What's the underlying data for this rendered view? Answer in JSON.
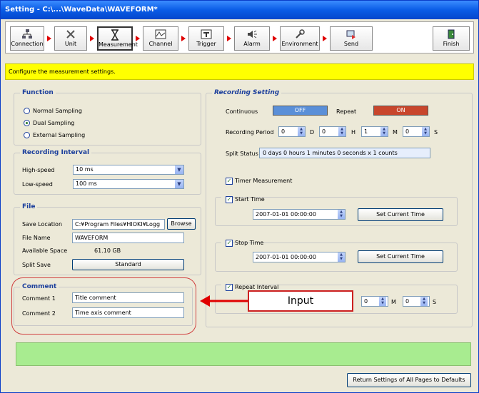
{
  "title": "Setting - C:\\...\\WaveData\\WAVEFORM*",
  "toolbar": {
    "steps": [
      "Connection",
      "Unit",
      "Measurement",
      "Channel",
      "Trigger",
      "Alarm",
      "Environment",
      "Send",
      "Finish"
    ],
    "active": "Measurement"
  },
  "info_text": "Configure the measurement settings.",
  "function": {
    "legend": "Function",
    "options": [
      "Normal Sampling",
      "Dual Sampling",
      "External Sampling"
    ],
    "selected": "Dual Sampling"
  },
  "recording_interval": {
    "legend": "Recording Interval",
    "high_label": "High-speed",
    "high_value": "10 ms",
    "low_label": "Low-speed",
    "low_value": "100 ms"
  },
  "file": {
    "legend": "File",
    "save_location_label": "Save Location",
    "save_location_value": "C:¥Program Files¥HIOKI¥Logg",
    "browse_label": "Browse",
    "file_name_label": "File Name",
    "file_name_value": "WAVEFORM",
    "available_space_label": "Available Space",
    "available_space_value": "61.10 GB",
    "split_save_label": "Split Save",
    "split_save_value": "Standard"
  },
  "comment": {
    "legend": "Comment",
    "comment1_label": "Comment 1",
    "comment1_value": "Title comment",
    "comment2_label": "Comment 2",
    "comment2_value": "Time axis comment"
  },
  "recording_setting": {
    "legend": "Recording Setting",
    "continuous_label": "Continuous",
    "continuous_value": "OFF",
    "repeat_label": "Repeat",
    "repeat_value": "ON",
    "period_label": "Recording Period",
    "period_d": "0",
    "period_h": "0",
    "period_m": "1",
    "period_s": "0",
    "unit_d": "D",
    "unit_h": "H",
    "unit_m": "M",
    "unit_s": "S",
    "split_status_label": "Split Status",
    "split_status_value": "0 days 0 hours 1 minutes 0 seconds x 1 counts",
    "timer_label": "Timer Measurement",
    "start_label": "Start Time",
    "start_value": "2007-01-01 00:00:00",
    "set_current_label": "Set Current Time",
    "stop_label": "Stop Time",
    "stop_value": "2007-01-01 00:00:00",
    "repeat_interval_label": "Repeat Interval",
    "repeat_interval_m": "0",
    "repeat_interval_s": "0"
  },
  "annotation_label": "Input",
  "reset_button": "Return Settings of All Pages to Defaults",
  "colors": {
    "titlebar": "#0a5ce6",
    "info": "#ffff00",
    "off": "#5a8fd8",
    "on": "#c8462c",
    "status_bar": "#a8ec90",
    "annotation": "#e00000"
  }
}
